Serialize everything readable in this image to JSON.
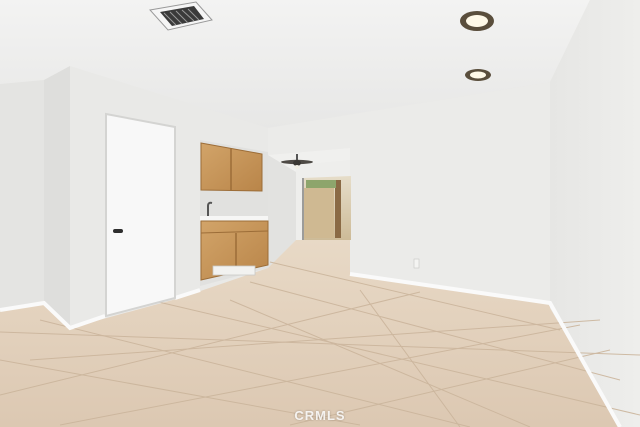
{
  "photo": {
    "subject": "empty-room-interior",
    "watermark": "CRMLS"
  }
}
